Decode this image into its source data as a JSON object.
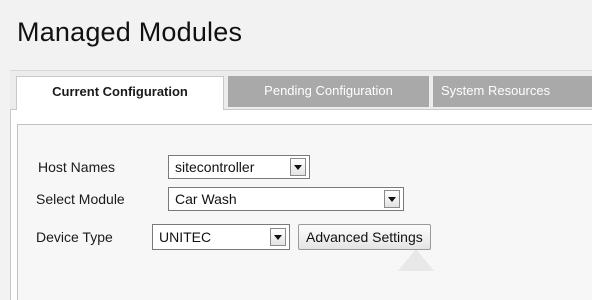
{
  "page": {
    "title": "Managed Modules"
  },
  "tabs": [
    {
      "label": "Current Configuration",
      "active": true
    },
    {
      "label": "Pending Configuration",
      "active": false
    },
    {
      "label": "System Resources",
      "active": false
    }
  ],
  "form": {
    "host_names": {
      "label": "Host Names",
      "value": "sitecontroller"
    },
    "select_module": {
      "label": "Select Module",
      "value": "Car Wash"
    },
    "device_type": {
      "label": "Device Type",
      "value": "UNITEC"
    },
    "advanced_settings_label": "Advanced Settings"
  },
  "colors": {
    "tab_inactive_bg": "#a9a9a9",
    "tab_active_bg": "#ffffff",
    "page_bg": "#f2f2f2"
  },
  "icons": {
    "dropdown": "chevron-down-icon"
  }
}
